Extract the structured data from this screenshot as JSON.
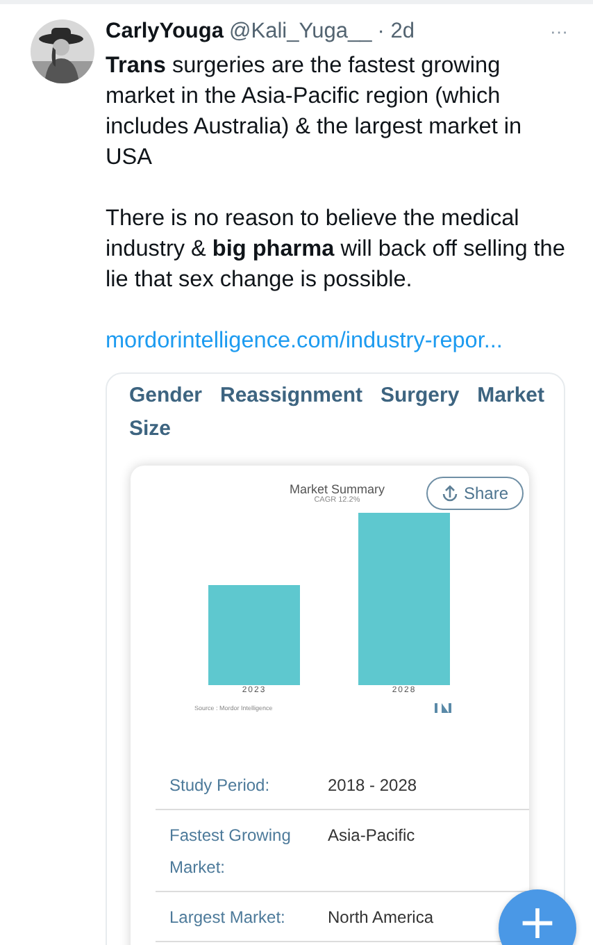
{
  "tweet": {
    "display_name": "CarlyYouga",
    "handle": "@Kali_Yuga__",
    "time": "· 2d",
    "more": "···",
    "paragraphs": [
      "**Trans** surgeries are the fastest growing market in the Asia-Pacific region (which includes Australia) & the largest market in USA",
      "There is no reason to believe the medical industry & **big pharma** will back off selling the lie that sex change is possible."
    ],
    "link": "mordorintelligence.com/industry-repor..."
  },
  "card": {
    "title": "Gender Reassignment Surgery Market Size",
    "chart": {
      "title": "Market Summary",
      "subtitle": "CAGR 12.2%",
      "share": "Share",
      "bars": [
        {
          "label": "2023"
        },
        {
          "label": "2028"
        }
      ],
      "source": "Source : Mordor Intelligence"
    },
    "rows": [
      {
        "label": "Study Period:",
        "value": "2018 - 2028"
      },
      {
        "label": "Fastest Growing Market:",
        "value": "Asia-Pacific"
      },
      {
        "label": "Largest Market:",
        "value": "North America"
      }
    ]
  },
  "fab": "+"
}
